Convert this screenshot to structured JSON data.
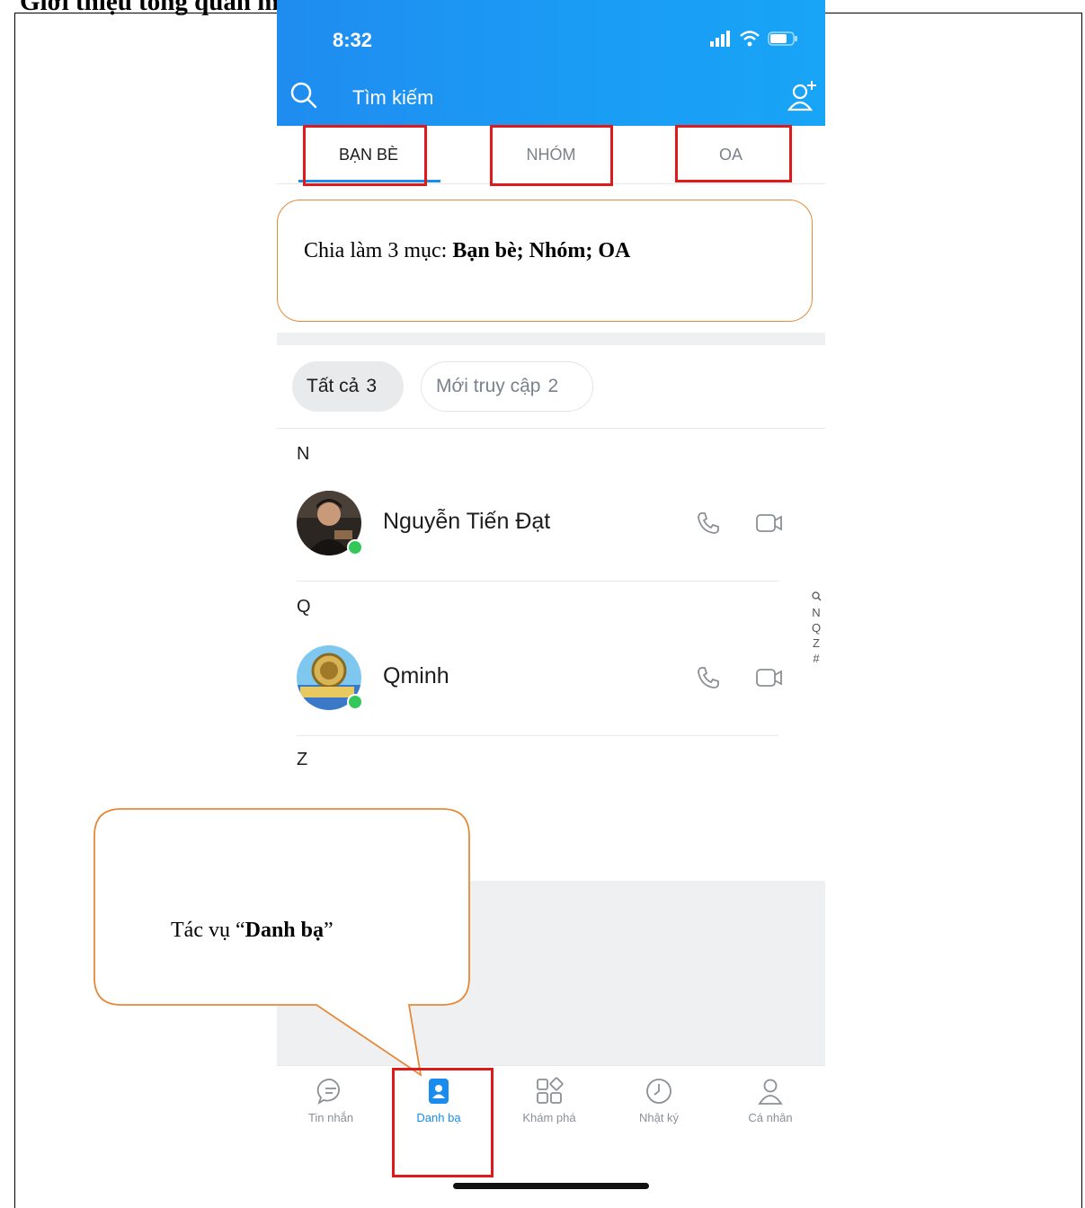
{
  "document": {
    "heading": "Giới thiệu tổng quan mục Danh bạ"
  },
  "status_bar": {
    "time": "8:32"
  },
  "search": {
    "placeholder": "Tìm kiếm"
  },
  "tabs": [
    {
      "label": "BẠN BÈ",
      "active": true
    },
    {
      "label": "NHÓM",
      "active": false
    },
    {
      "label": "OA",
      "active": false
    }
  ],
  "annotation_top": {
    "prefix": "Chia làm 3 mục: ",
    "bold": "Bạn bè; Nhóm; OA"
  },
  "filters": [
    {
      "label": "Tất cả",
      "count": "3",
      "selected": true
    },
    {
      "label": "Mới truy cập",
      "count": "2",
      "selected": false
    }
  ],
  "sections": [
    {
      "letter": "N",
      "contact": {
        "name": "Nguyễn Tiến Đạt",
        "online": true,
        "avatar": "photo-avatar"
      }
    },
    {
      "letter": "Q",
      "contact": {
        "name": "Qminh",
        "online": true,
        "avatar": "logo-avatar"
      }
    },
    {
      "letter": "Z"
    }
  ],
  "index_bar": [
    "Q",
    "N",
    "Q",
    "Z",
    "#"
  ],
  "annotation_bottom": {
    "prefix": "Tác vụ “",
    "bold": "Danh bạ",
    "suffix": "”"
  },
  "bottom_nav": [
    {
      "label": "Tin nhắn",
      "icon": "chat-bubble-icon",
      "active": false
    },
    {
      "label": "Danh bạ",
      "icon": "contacts-icon",
      "active": true
    },
    {
      "label": "Khám phá",
      "icon": "discover-grid-icon",
      "active": false
    },
    {
      "label": "Nhật ký",
      "icon": "clock-icon",
      "active": false
    },
    {
      "label": "Cá nhân",
      "icon": "person-icon",
      "active": false
    }
  ],
  "colors": {
    "header_blue": "#1a9df5",
    "accent_blue": "#1a8cf0",
    "highlight_red": "#e01a1a",
    "callout_orange": "#e58a3a",
    "online_green": "#34c759"
  }
}
